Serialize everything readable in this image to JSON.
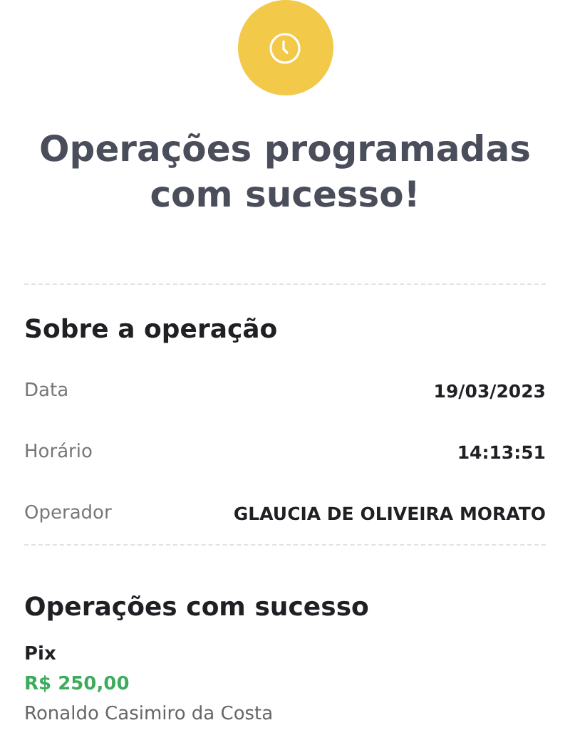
{
  "title": "Operações programadas com sucesso!",
  "about": {
    "heading": "Sobre a operação",
    "rows": [
      {
        "label": "Data",
        "value": "19/03/2023"
      },
      {
        "label": "Horário",
        "value": "14:13:51"
      },
      {
        "label": "Operador",
        "value": "GLAUCIA DE OLIVEIRA MORATO"
      }
    ]
  },
  "success": {
    "heading": "Operações com sucesso",
    "items": [
      {
        "type": "Pix",
        "amount": "R$ 250,00",
        "recipient": "Ronaldo Casimiro da Costa"
      }
    ]
  }
}
